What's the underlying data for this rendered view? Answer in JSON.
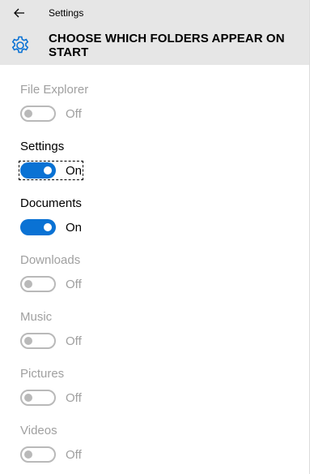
{
  "titlebar": {
    "back_icon": "back-arrow-icon",
    "title": "Settings"
  },
  "header": {
    "icon": "gear-icon",
    "title": "CHOOSE WHICH FOLDERS APPEAR ON START"
  },
  "colors": {
    "accent": "#0a72d4",
    "header_bg": "#e6e6e6",
    "disabled_text": "#a0a0a0"
  },
  "folders": [
    {
      "label": "File Explorer",
      "state": "Off",
      "on": false,
      "disabled": true
    },
    {
      "label": "Settings",
      "state": "On",
      "on": true,
      "disabled": false,
      "focused": true
    },
    {
      "label": "Documents",
      "state": "On",
      "on": true,
      "disabled": false
    },
    {
      "label": "Downloads",
      "state": "Off",
      "on": false,
      "disabled": true
    },
    {
      "label": "Music",
      "state": "Off",
      "on": false,
      "disabled": true
    },
    {
      "label": "Pictures",
      "state": "Off",
      "on": false,
      "disabled": true
    },
    {
      "label": "Videos",
      "state": "Off",
      "on": false,
      "disabled": true
    }
  ]
}
